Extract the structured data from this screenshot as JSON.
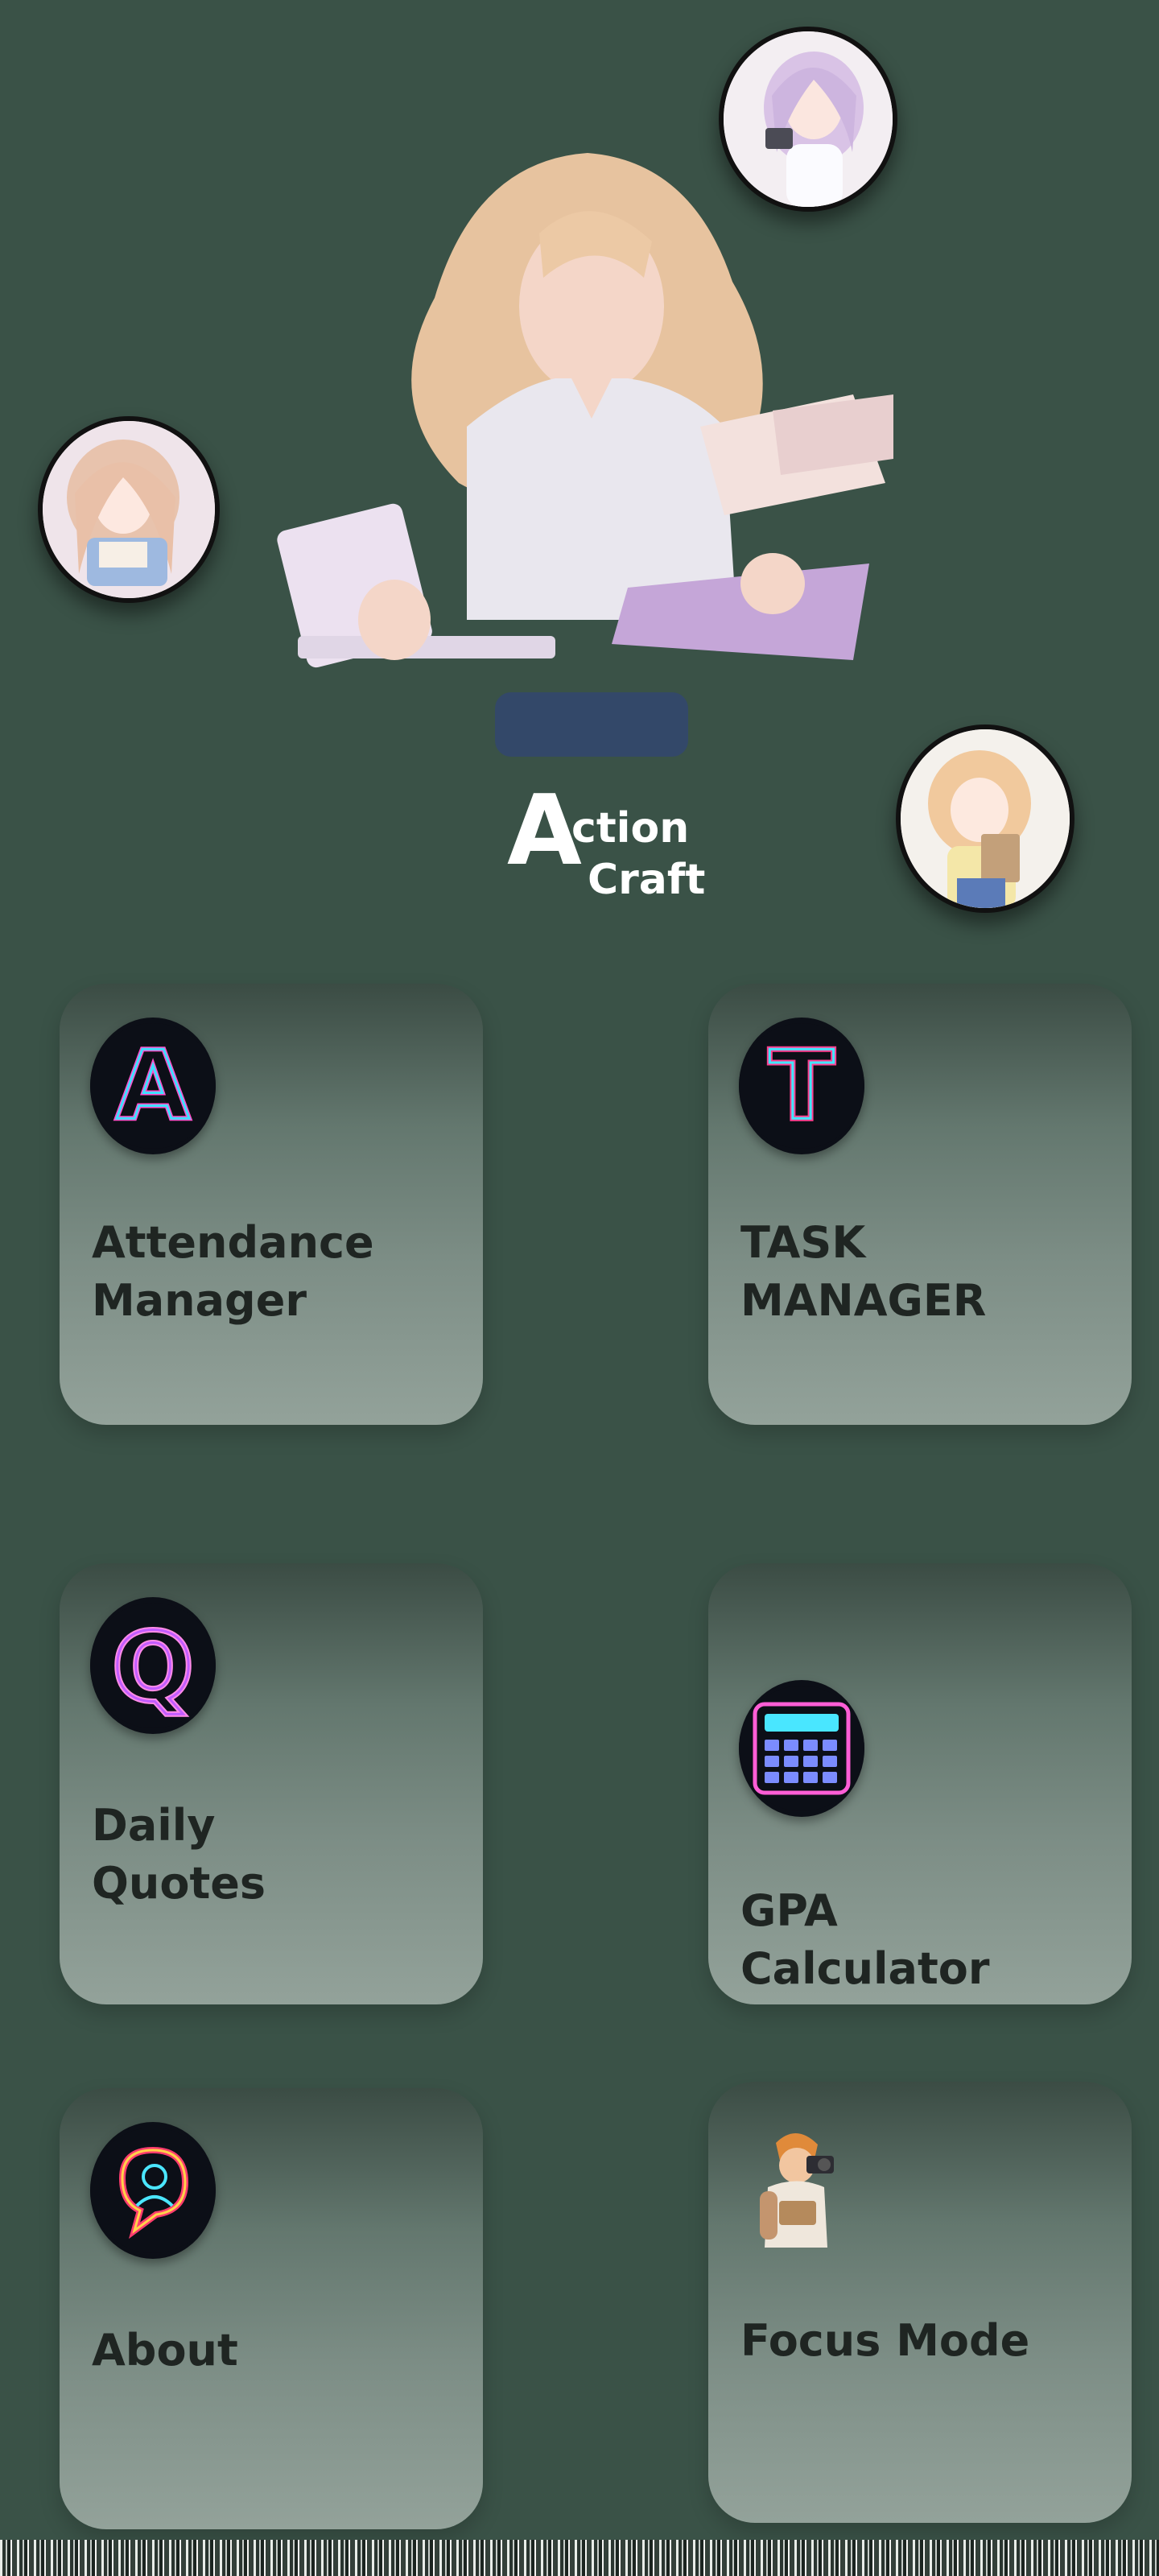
{
  "app": {
    "logo_big": "A",
    "logo_word1": "ction",
    "logo_word2": "Craft"
  },
  "cards": [
    {
      "label": "Attendance\nManager",
      "icon": "neon-letter-a-icon",
      "glyph": "A",
      "color": "#3fe0ff"
    },
    {
      "label": "TASK\nMANAGER",
      "icon": "neon-letter-t-icon",
      "glyph": "T",
      "color": "#3fe8ff"
    },
    {
      "label": "Daily\nQuotes",
      "icon": "neon-letter-q-icon",
      "glyph": "Q",
      "color": "#e16bff"
    },
    {
      "label": "GPA\nCalculator",
      "icon": "neon-calculator-icon"
    },
    {
      "label": "About",
      "icon": "neon-person-chat-icon"
    },
    {
      "label": "Focus Mode",
      "icon": "photographer-character-icon"
    }
  ],
  "colors": {
    "background": "#3a5247",
    "card_text": "#1f2522",
    "logo_text": "#ffffff"
  }
}
